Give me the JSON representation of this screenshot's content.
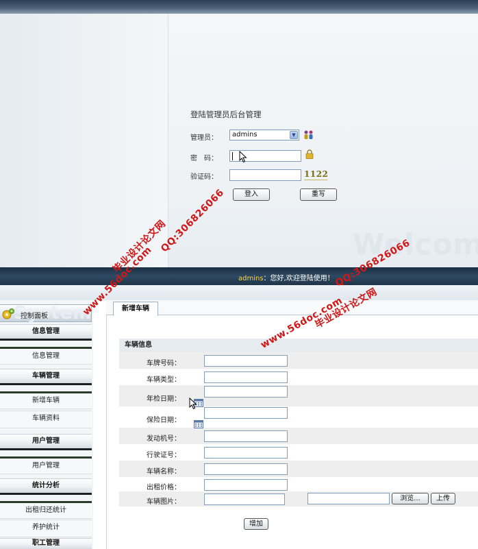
{
  "login": {
    "title": "登陆管理员后台管理",
    "admin_label": "管理员：",
    "admin_value": "admins",
    "password_label": "密　码：",
    "captcha_label": "验证码：",
    "captcha_value": "1122",
    "login_button": "登入",
    "reset_button": "重写",
    "welcome_text": "Welcome"
  },
  "header": {
    "user": "admins",
    "greeting": "：您好,欢迎登陆使用！"
  },
  "sidebar": {
    "header_label": "控制面板",
    "header_bg_text": "System",
    "sections": [
      {
        "label": "信息管理",
        "items": [
          "信息管理"
        ]
      },
      {
        "label": "车辆管理",
        "items": [
          "新增车辆",
          "车辆资料"
        ]
      },
      {
        "label": "用户管理",
        "items": [
          "用户管理"
        ]
      },
      {
        "label": "统计分析",
        "items": [
          "出租归还统计",
          "养护统计"
        ]
      },
      {
        "label": "职工管理",
        "items": []
      }
    ]
  },
  "main": {
    "tab_label": "新增车辆",
    "section_title": "车辆信息",
    "fields": {
      "plate": "车牌号码：",
      "type": "车辆类型：",
      "inspection_date": "年检日期：",
      "insurance_date": "保险日期：",
      "engine": "发动机号：",
      "license": "行驶证号：",
      "name": "车辆名称：",
      "rent_price": "出租价格：",
      "image": "车辆图片："
    },
    "browse_button": "浏览...",
    "upload_button": "上传",
    "add_button": "增加"
  },
  "watermarks": {
    "site_name": "毕业设计论文网",
    "site_url": "www.56doc.com",
    "qq": "QQ:306826066"
  }
}
